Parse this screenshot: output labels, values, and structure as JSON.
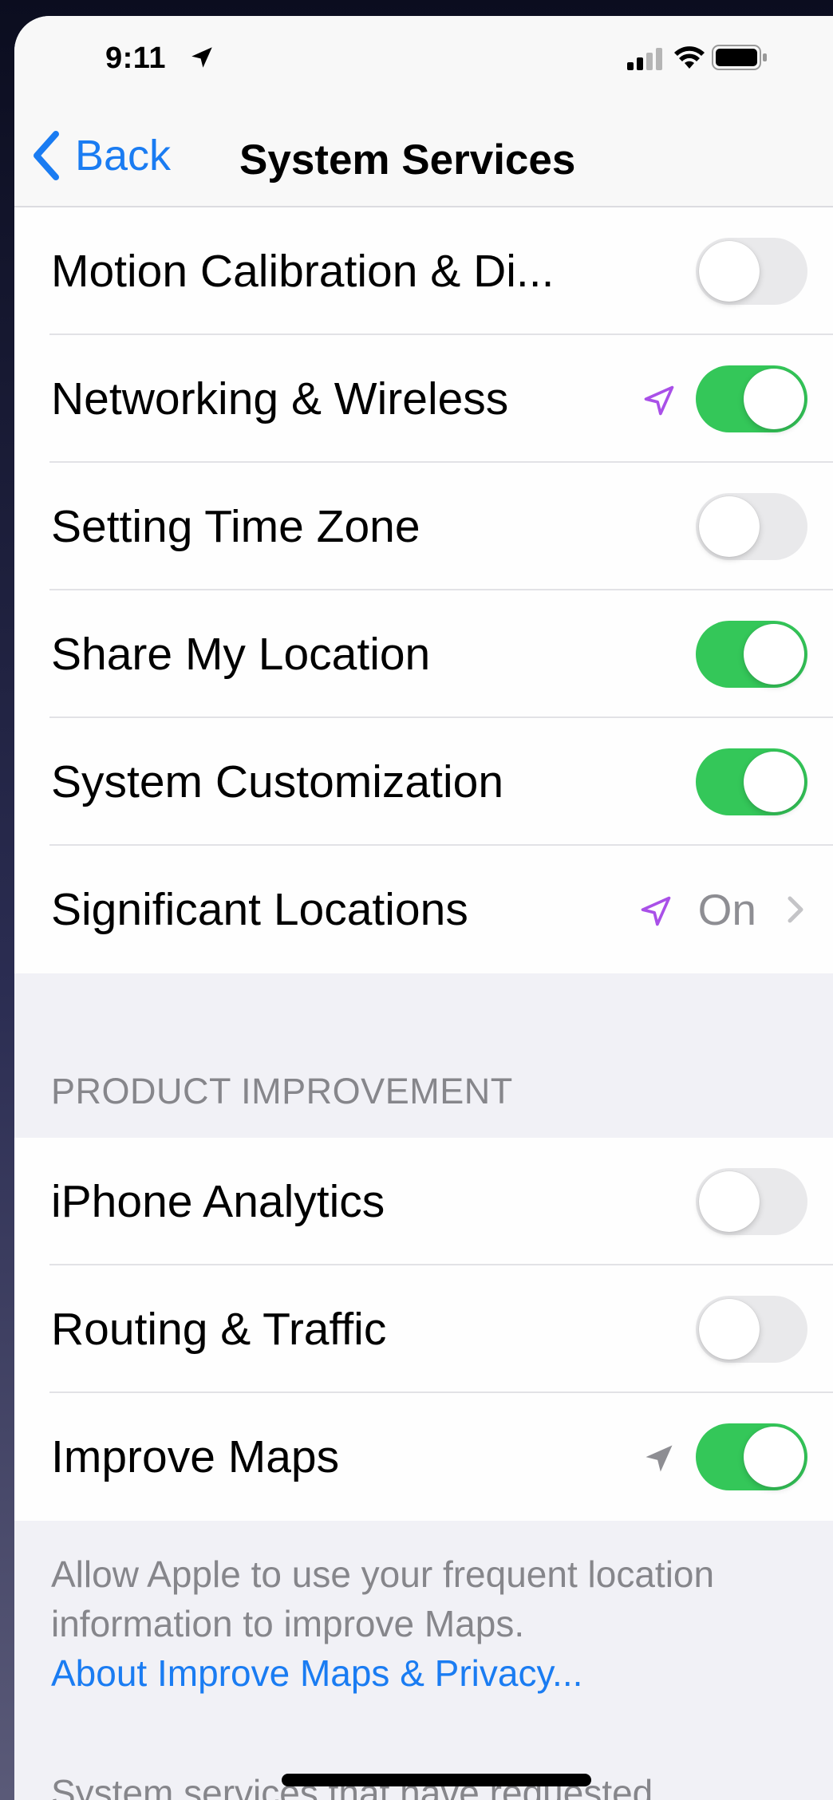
{
  "status_bar": {
    "time": "9:11"
  },
  "nav": {
    "back_label": "Back",
    "title": "System Services"
  },
  "rows_top": [
    {
      "label": "Motion Calibration & Di...",
      "toggle": false,
      "location_arrow": null
    },
    {
      "label": "Networking & Wireless",
      "toggle": true,
      "location_arrow": "purple"
    },
    {
      "label": "Setting Time Zone",
      "toggle": false,
      "location_arrow": null
    },
    {
      "label": "Share My Location",
      "toggle": true,
      "location_arrow": null
    },
    {
      "label": "System Customization",
      "toggle": true,
      "location_arrow": null
    },
    {
      "label": "Significant Locations",
      "value": "On",
      "location_arrow": "purple"
    }
  ],
  "product_improvement": {
    "header": "PRODUCT IMPROVEMENT",
    "rows": [
      {
        "label": "iPhone Analytics",
        "toggle": false,
        "location_arrow": null
      },
      {
        "label": "Routing & Traffic",
        "toggle": false,
        "location_arrow": null
      },
      {
        "label": "Improve Maps",
        "toggle": true,
        "location_arrow": "gray"
      }
    ],
    "footer_text": "Allow Apple to use your frequent location information to improve Maps.",
    "footer_link": "About Improve Maps & Privacy..."
  },
  "bottom_partial_text": "System services that have requested",
  "colors": {
    "accent": "#1a7cf2",
    "toggle_on": "#34c759",
    "toggle_off": "#e9e9eb",
    "location_purple": "#a950e8",
    "location_gray": "#8e8e93"
  },
  "icons": {
    "back": "chevron-left-icon",
    "location": "location-arrow-icon",
    "chevron": "chevron-right-icon",
    "signal": "cellular-signal-icon",
    "wifi": "wifi-icon",
    "battery": "battery-icon"
  }
}
